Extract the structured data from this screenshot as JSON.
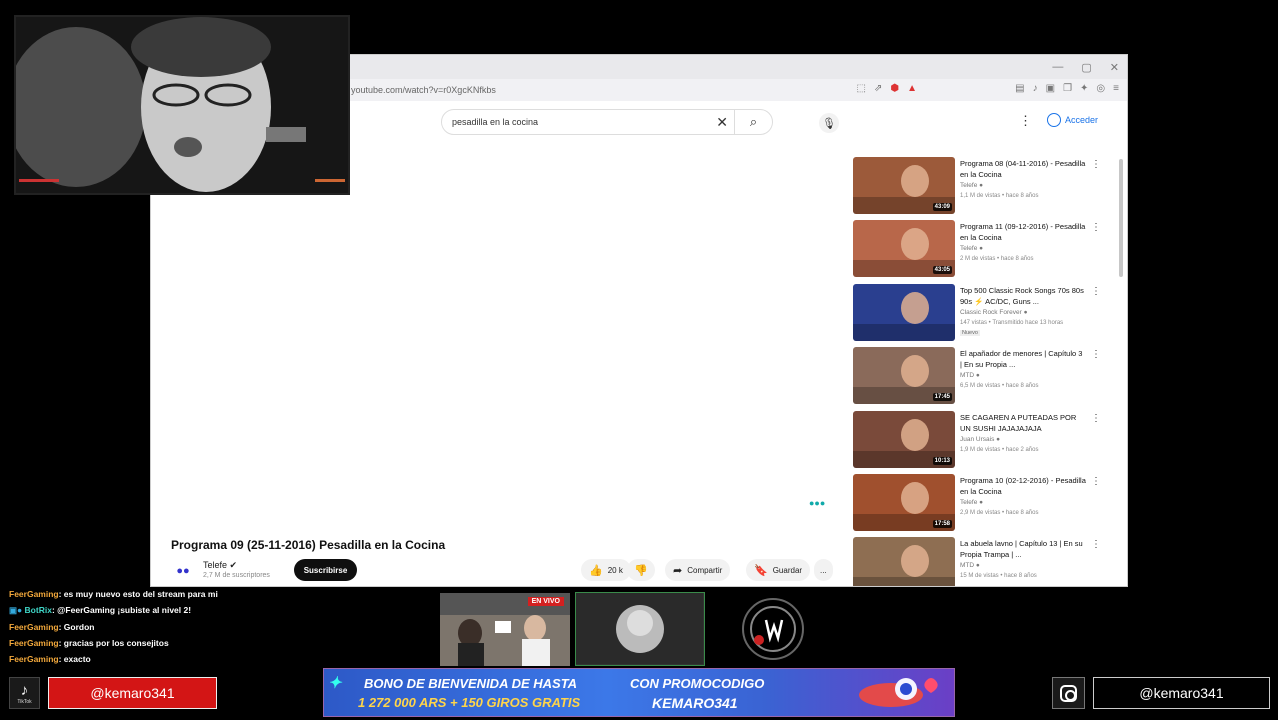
{
  "browser": {
    "url": "youtube.com/watch?v=r0XgcKNfkbs",
    "search_value": "pesadilla en la cocina",
    "signin_label": "Acceder"
  },
  "video": {
    "title": "Programa 09 (25-11-2016) Pesadilla en la Cocina",
    "channel": "Telefe",
    "subscribers": "2,7 M de suscriptores",
    "subscribe_label": "Suscribirse",
    "likes": "20 k",
    "share_label": "Compartir",
    "save_label": "Guardar",
    "more_label": "..."
  },
  "sidebar": {
    "items": [
      {
        "title": "Programa 08 (04-11-2016) - Pesadilla en la Cocina",
        "channel": "Telefe",
        "meta": "1,1 M de vistas • hace 8 años",
        "duration": "43:09",
        "color": "#9c5a3a"
      },
      {
        "title": "Programa 11 (09-12-2016) - Pesadilla en la Cocina",
        "channel": "Telefe",
        "meta": "2 M de vistas • hace 8 años",
        "duration": "43:05",
        "color": "#b8674a"
      },
      {
        "title": "Top 500 Classic Rock Songs 70s 80s 90s ⚡ AC/DC, Guns ...",
        "channel": "Classic Rock Forever",
        "meta": "147 vistas • Transmitido hace 13 horas",
        "badge": "Nuevo",
        "duration": "",
        "color": "#2a3f8f"
      },
      {
        "title": "El apañador de menores | Capítulo 3 | En su Propia ...",
        "channel": "MTD",
        "meta": "6,5 M de vistas • hace 8 años",
        "duration": "17:45",
        "color": "#8a6a5a"
      },
      {
        "title": "SE CAGAREN A PUTEADAS POR UN SUSHI JAJAJAJAJA",
        "channel": "Juan Ursais",
        "meta": "1,9 M de vistas • hace 2 años",
        "duration": "10:13",
        "color": "#7a4a3a"
      },
      {
        "title": "Programa 10 (02-12-2016) - Pesadilla en la Cocina",
        "channel": "Telefe",
        "meta": "2,9 M de vistas • hace 8 años",
        "duration": "17:58",
        "color": "#a0502e"
      },
      {
        "title": "La abuela lavno | Capítulo 13 | En su Propia Trampa | ...",
        "channel": "MTD",
        "meta": "15 M de vistas • hace 8 años",
        "duration": "",
        "color": "#8e6e52"
      }
    ]
  },
  "chat": [
    {
      "user": "FeerGaming",
      "text": ": es muy nuevo esto del stream para mi",
      "bot": false
    },
    {
      "user": "BotRix",
      "text": ": @FeerGaming ¡subiste al nivel 2!",
      "bot": true
    },
    {
      "user": "FeerGaming",
      "text": ": Gordon",
      "bot": false
    },
    {
      "user": "FeerGaming",
      "text": ": gracias por los consejitos",
      "bot": false
    },
    {
      "user": "FeerGaming",
      "text": ": exacto",
      "bot": false
    }
  ],
  "overlay": {
    "live_badge": "EN VIVO",
    "tiktok_label": "TikTok",
    "tiktok_handle": "@kemaro341",
    "instagram_handle": "@kemaro341",
    "banner_line1": "BONO DE BIENVENIDA DE HASTA",
    "banner_line2": "1 272 000 ARS + 150 GIROS GRATIS",
    "banner_line3": "CON PROMOCODIGO",
    "banner_line4": "KEMARO341"
  }
}
